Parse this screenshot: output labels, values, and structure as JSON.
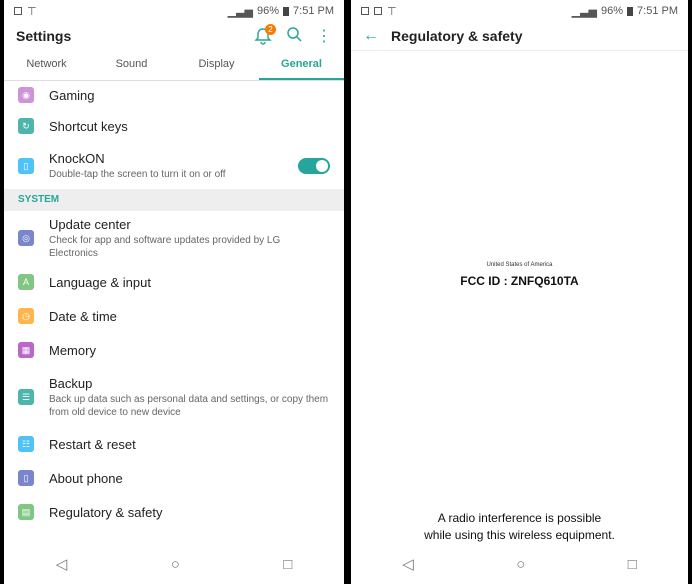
{
  "status_bar": {
    "battery": "96%",
    "time": "7:51 PM"
  },
  "settings": {
    "title": "Settings",
    "notification_count": "2",
    "tabs": [
      "Network",
      "Sound",
      "Display",
      "General"
    ],
    "active_tab": "General",
    "items_top": [
      {
        "label": "Gaming",
        "icon": "gamepad-icon",
        "color": "#ce93d8"
      },
      {
        "label": "Shortcut keys",
        "icon": "shortcut-icon",
        "color": "#4db6ac"
      },
      {
        "label": "KnockON",
        "desc": "Double-tap the screen to turn it on or off",
        "icon": "knockon-icon",
        "color": "#4fc3f7",
        "toggle": true
      }
    ],
    "section_system": "SYSTEM",
    "items_system": [
      {
        "label": "Update center",
        "desc": "Check for app and software updates provided by LG Electronics",
        "icon": "update-icon",
        "color": "#7986cb"
      },
      {
        "label": "Language & input",
        "icon": "language-icon",
        "color": "#81c784"
      },
      {
        "label": "Date & time",
        "icon": "clock-icon",
        "color": "#ffb74d"
      },
      {
        "label": "Memory",
        "icon": "memory-icon",
        "color": "#ba68c8"
      },
      {
        "label": "Backup",
        "desc": "Back up data such as personal data and settings, or copy them from old device to new device",
        "icon": "backup-icon",
        "color": "#4db6ac"
      },
      {
        "label": "Restart & reset",
        "icon": "reset-icon",
        "color": "#4fc3f7"
      },
      {
        "label": "About phone",
        "icon": "about-icon",
        "color": "#7986cb"
      },
      {
        "label": "Regulatory & safety",
        "icon": "regulatory-icon",
        "color": "#81c784"
      }
    ]
  },
  "regulatory": {
    "title": "Regulatory & safety",
    "country": "United States of America",
    "fcc_id": "FCC ID : ZNFQ610TA",
    "notice_line1": "A radio interference is possible",
    "notice_line2": "while using this wireless equipment."
  },
  "accent_color": "#26a69a"
}
